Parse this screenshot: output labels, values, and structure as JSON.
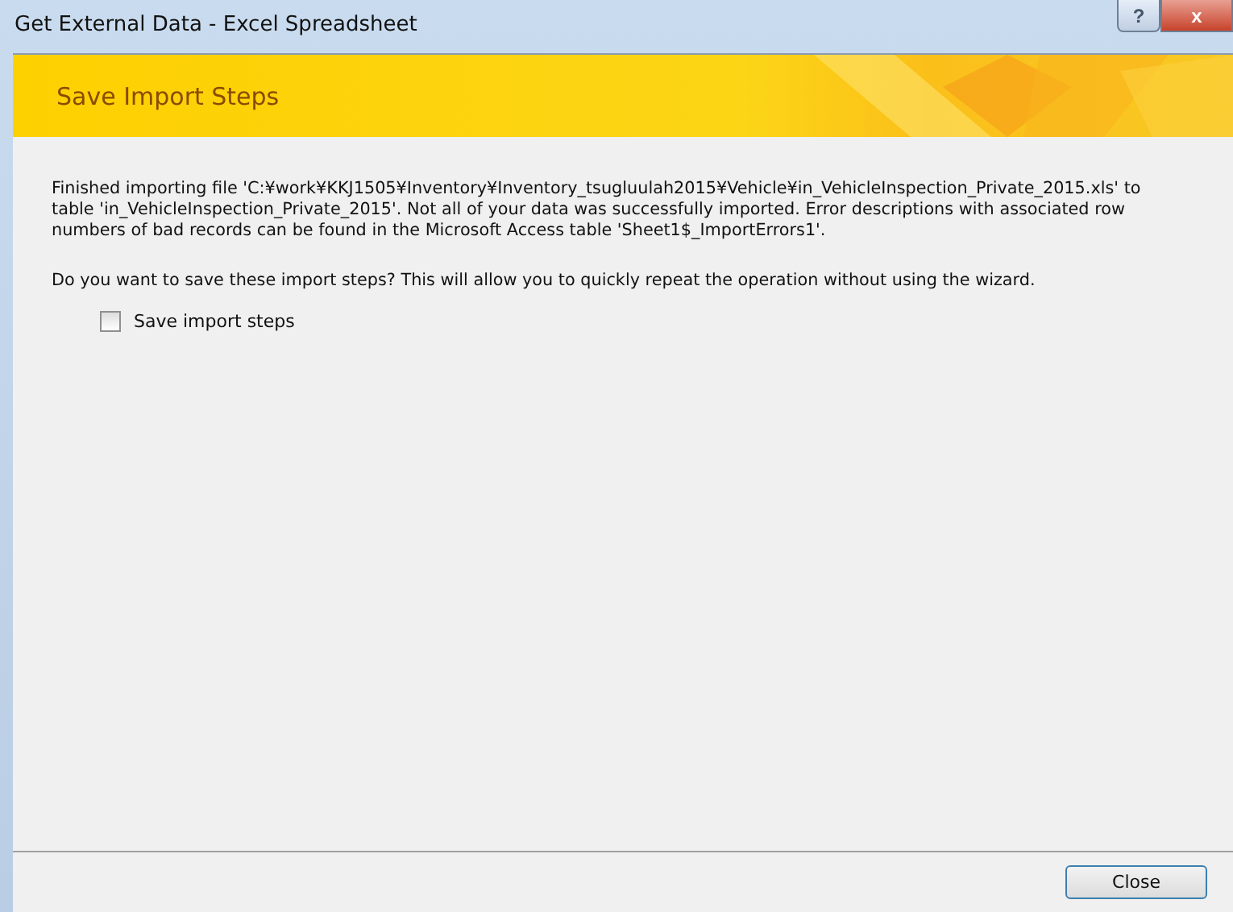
{
  "window": {
    "title": "Get External Data - Excel Spreadsheet",
    "buttons": [
      {
        "kind": "help",
        "label": "?"
      },
      {
        "kind": "close",
        "label": "x"
      }
    ]
  },
  "banner": {
    "title": "Save Import Steps"
  },
  "message": "Finished importing file 'C:¥work¥KKJ1505¥Inventory¥Inventory_tsugluulah2015¥Vehicle¥in_VehicleInspection_Private_2015.xls' to table 'in_VehicleInspection_Private_2015'.  Not all of your data was successfully imported. Error descriptions with associated row numbers of bad records can be found in the Microsoft Access table 'Sheet1$_ImportErrors1'.",
  "question": "Do you want to save these import steps? This will allow you to quickly repeat the operation without using the wizard.",
  "save_checkbox": {
    "label": "Save import steps",
    "checked": false
  },
  "footer": {
    "buttons": [
      "Close"
    ]
  }
}
